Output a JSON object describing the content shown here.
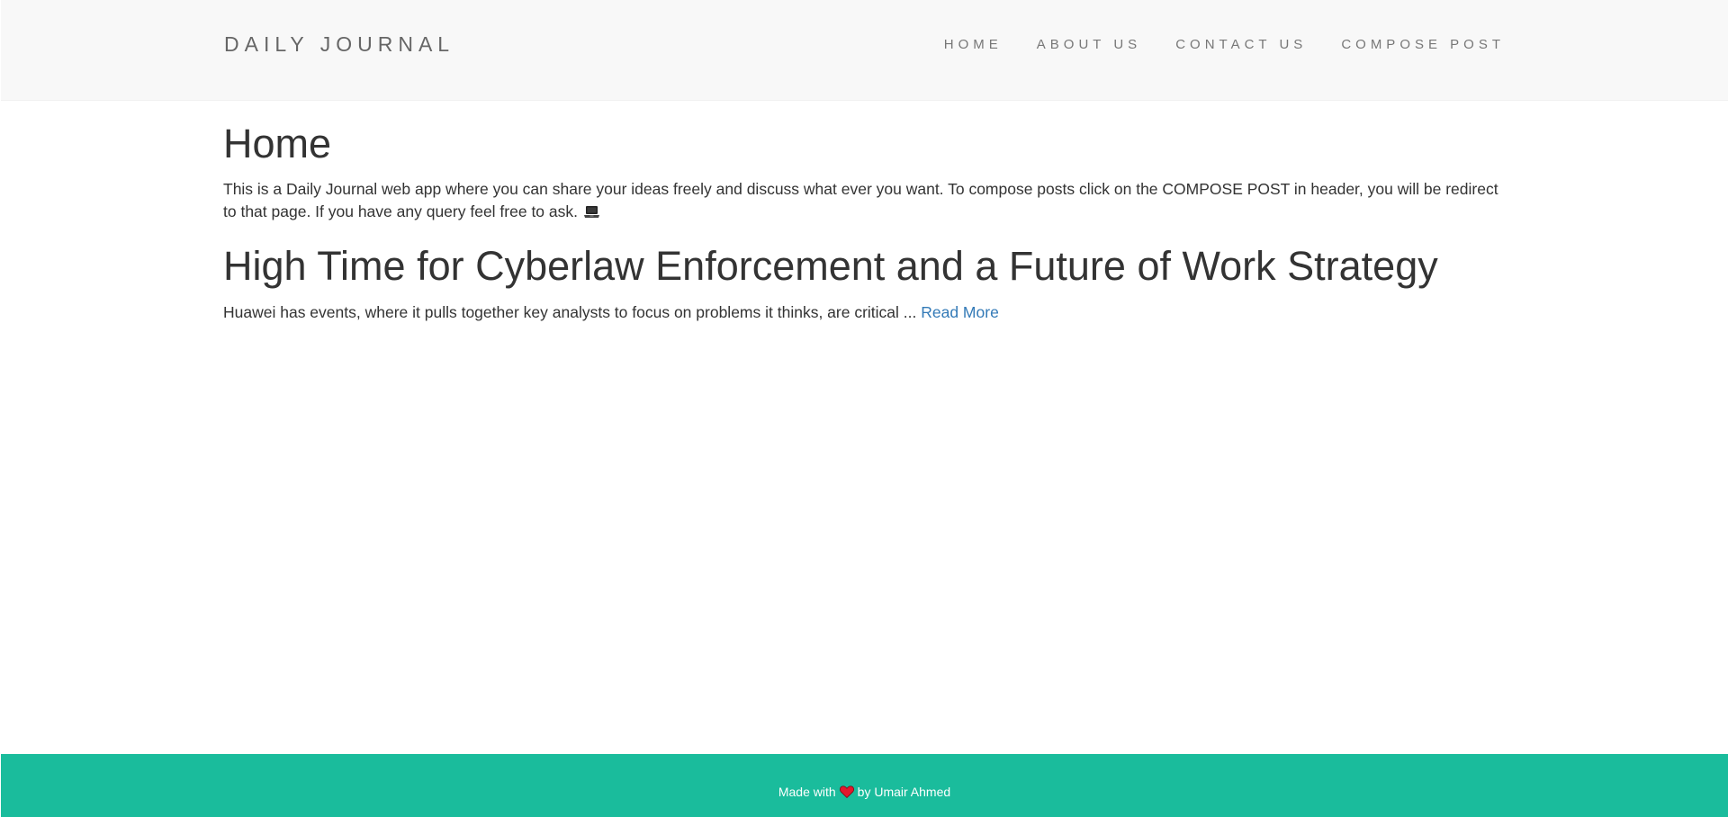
{
  "navbar": {
    "brand": "DAILY JOURNAL",
    "items": [
      {
        "label": "HOME"
      },
      {
        "label": "ABOUT US"
      },
      {
        "label": "CONTACT US"
      },
      {
        "label": "COMPOSE POST"
      }
    ]
  },
  "home": {
    "title": "Home",
    "intro": "This is a Daily Journal web app where you can share your ideas freely and discuss what ever you want. To compose posts click on the COMPOSE POST in header, you will be redirect to that page. If you have any query feel free to ask.",
    "intro_icon": "laptop-icon"
  },
  "posts": [
    {
      "title": "High Time for Cyberlaw Enforcement and a Future of Work Strategy",
      "excerpt": "Huawei has events, where it pulls together key analysts to focus on problems it thinks, are critical ...",
      "read_more": "Read More"
    }
  ],
  "footer": {
    "prefix": "Made with",
    "icon": "heart-icon",
    "suffix": "by Umair Ahmed"
  },
  "colors": {
    "navbar_bg": "#f8f8f8",
    "footer_bg": "#1abc9c",
    "link": "#337ab7",
    "heart": "#e3182d"
  }
}
